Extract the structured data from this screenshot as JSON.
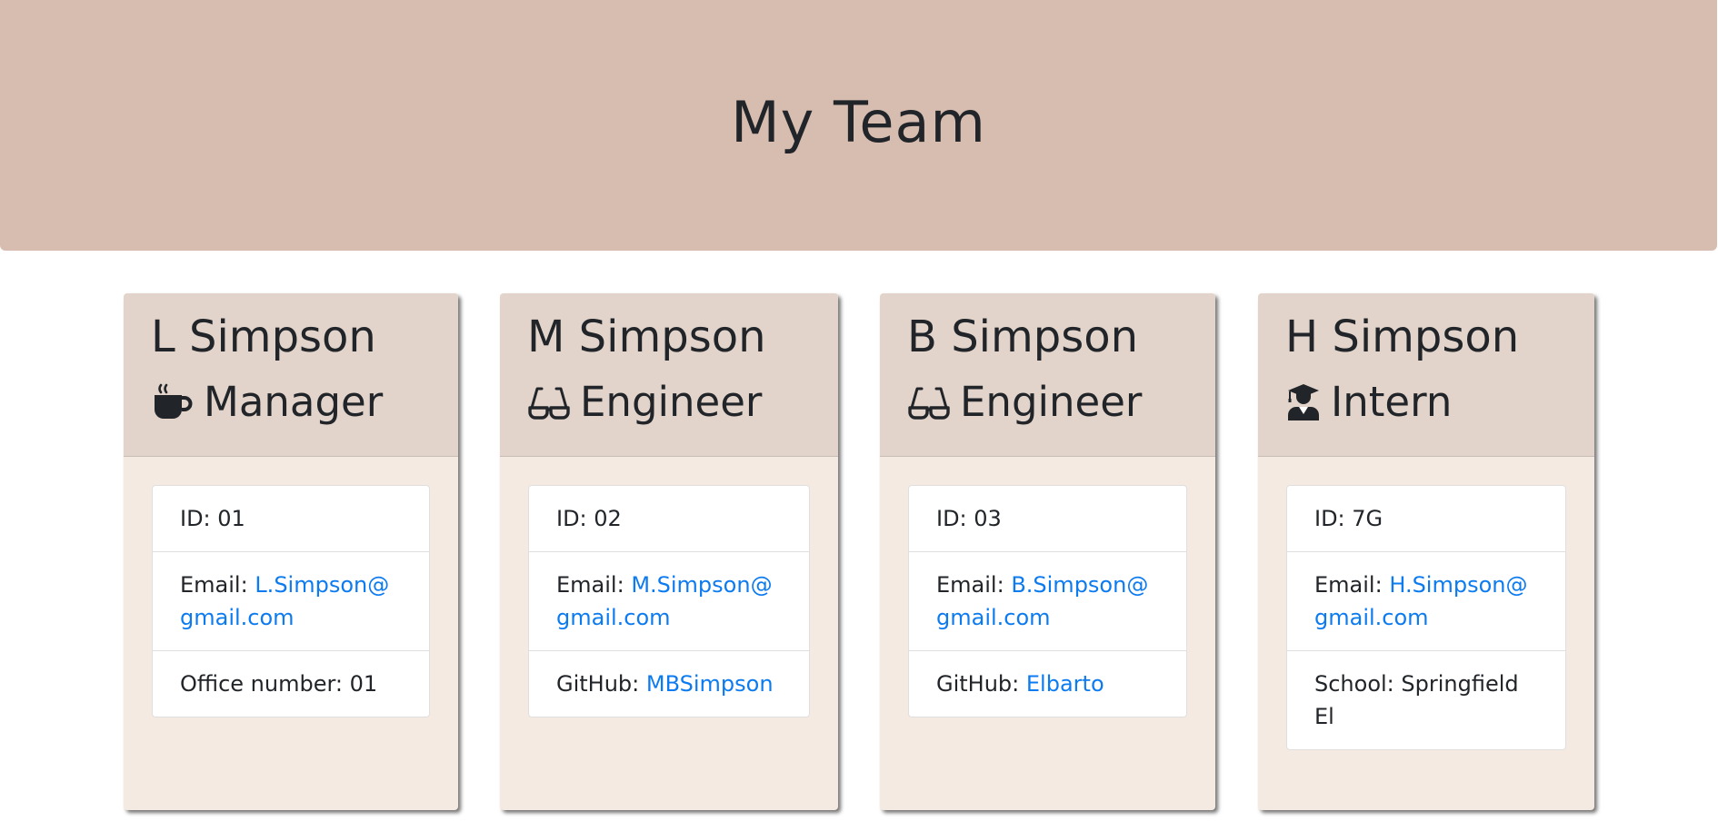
{
  "header": {
    "title": "My Team"
  },
  "team": [
    {
      "name": "L Simpson",
      "role": "Manager",
      "role_icon": "coffee-icon",
      "id_label": "ID: 01",
      "email_label": "Email: ",
      "email": "L.Simpson@gmail.com",
      "extra_label": "Office number: 01"
    },
    {
      "name": "M Simpson",
      "role": "Engineer",
      "role_icon": "glasses-icon",
      "id_label": "ID: 02",
      "email_label": "Email: ",
      "email": "M.Simpson@gmail.com",
      "extra_label": "GitHub: ",
      "extra_link": "MBSimpson"
    },
    {
      "name": "B Simpson",
      "role": "Engineer",
      "role_icon": "glasses-icon",
      "id_label": "ID: 03",
      "email_label": "Email: ",
      "email": "B.Simpson@gmail.com",
      "extra_label": "GitHub: ",
      "extra_link": "Elbarto"
    },
    {
      "name": "H Simpson",
      "role": "Intern",
      "role_icon": "graduate-icon",
      "id_label": "ID: 7G",
      "email_label": "Email: ",
      "email": "H.Simpson@gmail.com",
      "extra_label": "School: Springfield El"
    }
  ],
  "colors": {
    "header_bg": "#d7bdb0",
    "card_header_bg": "#e2d4ca",
    "card_body_bg": "#f4eae1",
    "link": "#0d7bf0"
  }
}
